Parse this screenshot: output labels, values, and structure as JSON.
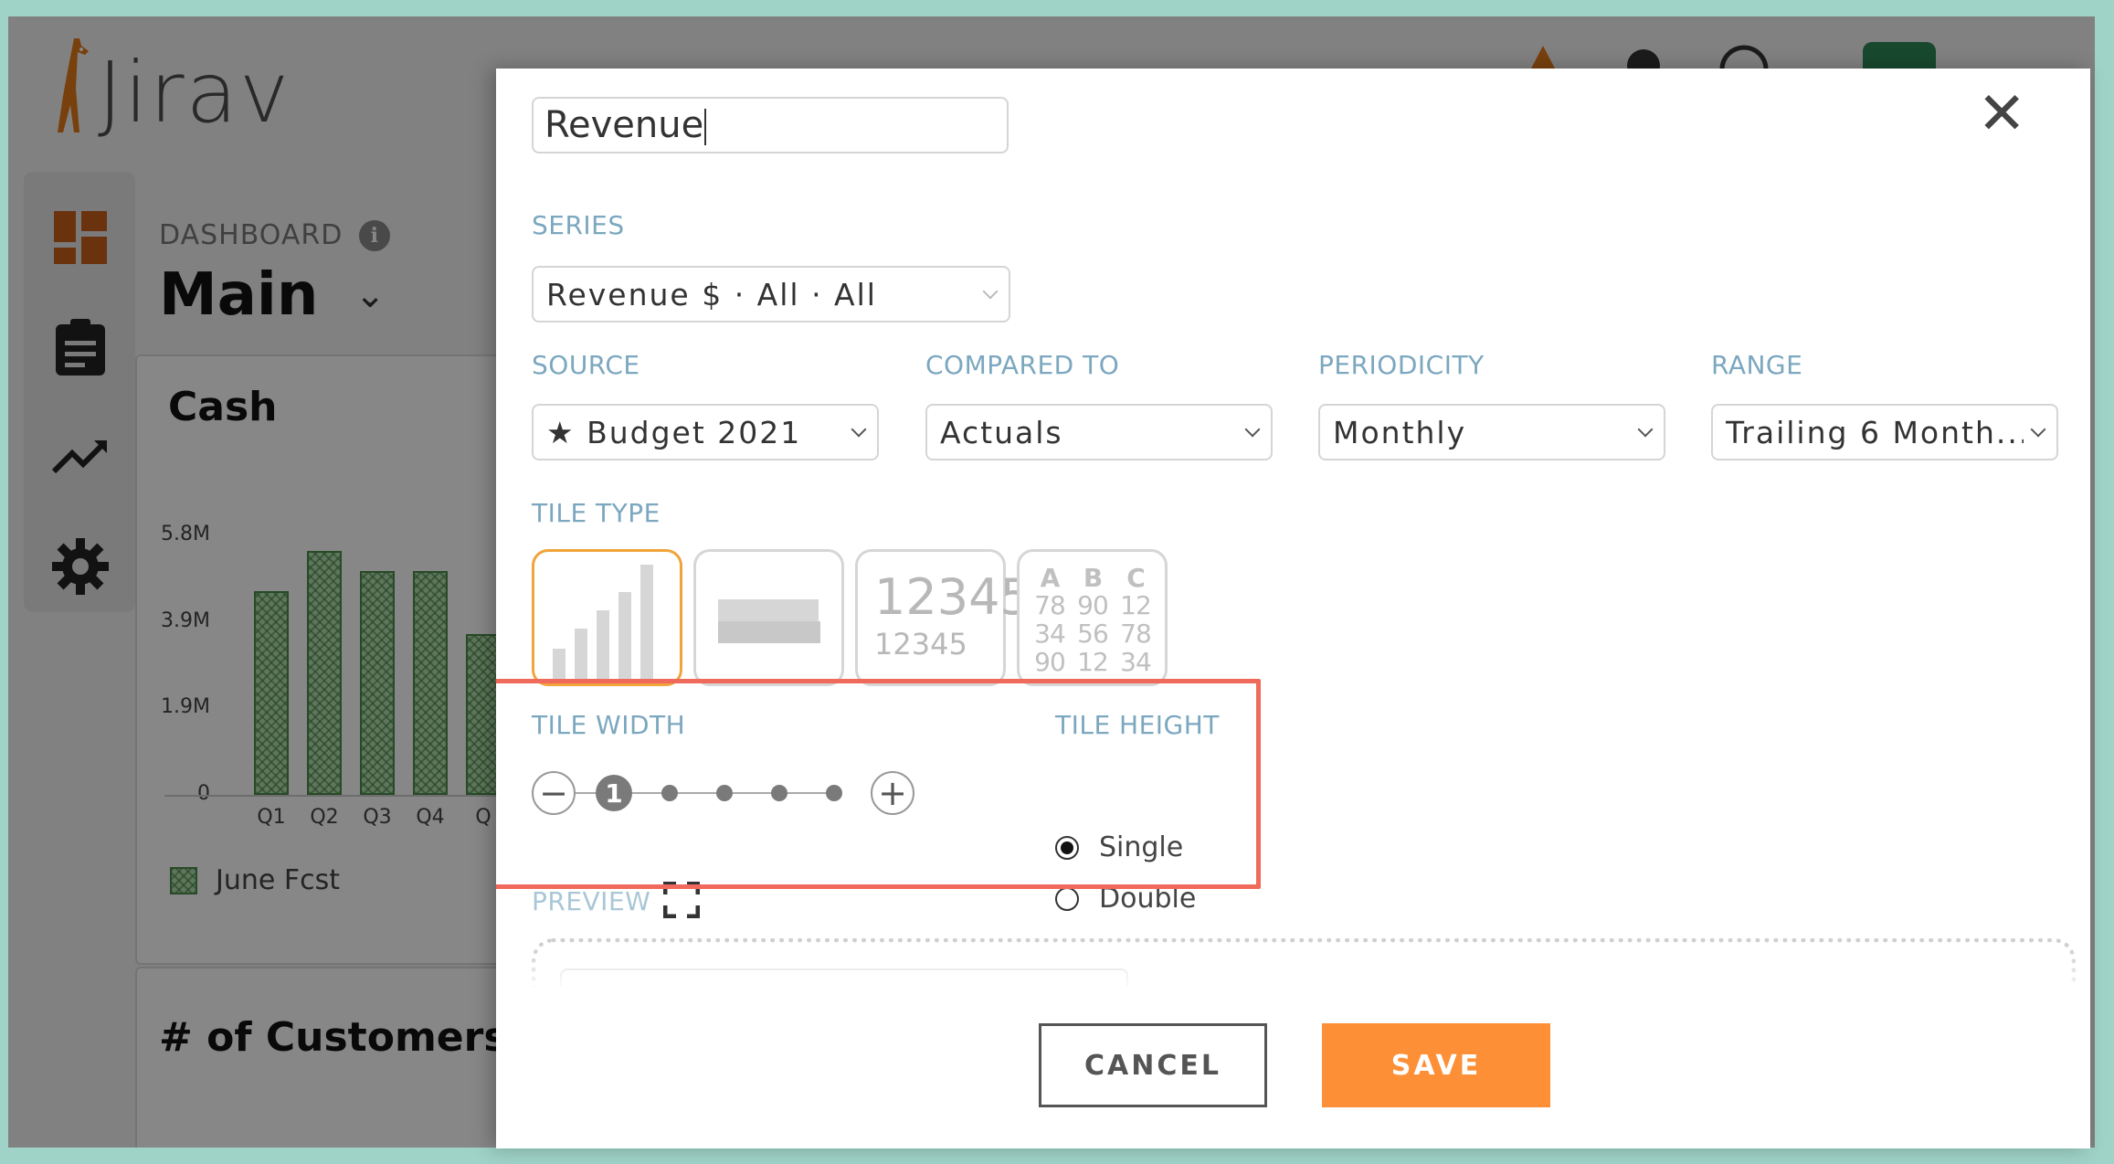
{
  "app": {
    "logo_text": "Jirav",
    "dashboard_label": "DASHBOARD",
    "dashboard_name": "Main",
    "cash_card": {
      "title": "Cash",
      "legend": "June Fcst"
    },
    "customers_card": {
      "title": "# of Customers"
    }
  },
  "chart_data": {
    "type": "bar",
    "title": "Cash",
    "categories": [
      "Q1",
      "Q2",
      "Q3",
      "Q4",
      "Q"
    ],
    "series": [
      {
        "name": "June Fcst",
        "values": [
          4.55,
          5.45,
          5.0,
          5.0,
          3.6
        ]
      }
    ],
    "yticks": [
      "5.8M",
      "3.9M",
      "1.9M",
      "0"
    ],
    "ylim": [
      0,
      5.8
    ],
    "legend": "bottom-left"
  },
  "modal": {
    "title_value": "Revenue",
    "series_label": "SERIES",
    "series_value": "Revenue $ · All · All",
    "source_label": "SOURCE",
    "source_value": "★ Budget 2021",
    "compared_label": "COMPARED TO",
    "compared_value": "Actuals",
    "periodicity_label": "PERIODICITY",
    "periodicity_value": "Monthly",
    "range_label": "RANGE",
    "range_value": "Trailing 6 Month...",
    "tile_type_label": "TILE TYPE",
    "tile_types": {
      "number_big": "12345",
      "number_small": "12345",
      "table_headers": [
        "A",
        "B",
        "C"
      ],
      "table_rows": [
        [
          "78",
          "90",
          "12"
        ],
        [
          "34",
          "56",
          "78"
        ],
        [
          "90",
          "12",
          "34"
        ]
      ]
    },
    "tile_width_label": "TILE WIDTH",
    "tile_width": {
      "minus": "−",
      "plus": "+",
      "current": "1",
      "value": 1,
      "max": 6
    },
    "tile_height_label": "TILE HEIGHT",
    "tile_height_options": [
      "Single",
      "Double"
    ],
    "tile_height_selected": "Single",
    "preview_label": "PREVIEW",
    "cancel_label": "CANCEL",
    "save_label": "SAVE",
    "close_symbol": "✕"
  },
  "colors": {
    "accent_orange": "#fd8f36",
    "label_blue": "#7ba7bf",
    "highlight_red": "#ef6a5a",
    "selected_tile_border": "#f0a43a",
    "bar_green": "#b5ddb0"
  }
}
